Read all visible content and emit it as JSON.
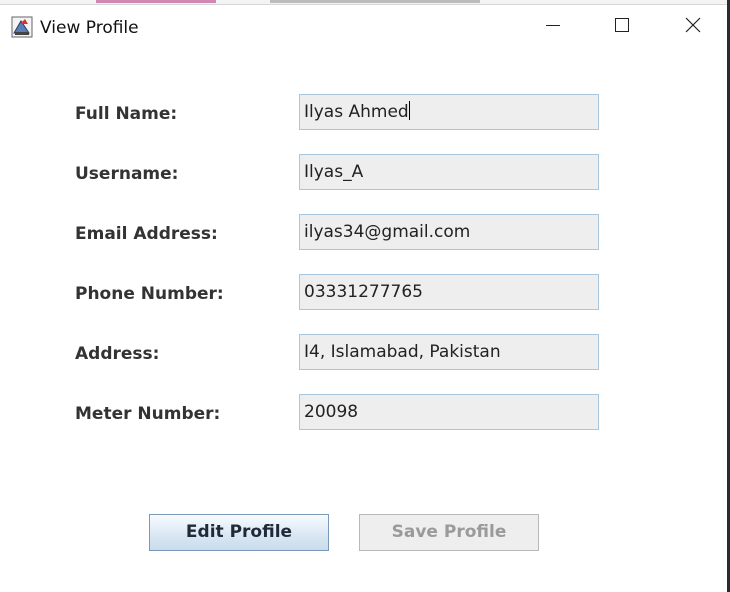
{
  "window": {
    "title": "View Profile",
    "icons": {
      "app": "app-logo-icon",
      "minimize": "minimize-icon",
      "maximize": "maximize-icon",
      "close": "close-icon"
    }
  },
  "form": {
    "fields": [
      {
        "label": "Full Name:",
        "value": "Ilyas Ahmed"
      },
      {
        "label": "Username:",
        "value": "Ilyas_A"
      },
      {
        "label": "Email Address:",
        "value": "ilyas34@gmail.com"
      },
      {
        "label": "Phone Number:",
        "value": "03331277765"
      },
      {
        "label": "Address:",
        "value": "I4, Islamabad, Pakistan"
      },
      {
        "label": "Meter Number:",
        "value": "20098"
      }
    ]
  },
  "buttons": {
    "edit_label": "Edit Profile",
    "save_label": "Save Profile"
  },
  "colors": {
    "field_bg": "#eeeeee",
    "field_border": "#a9c6dc",
    "label_text": "#333333",
    "disabled_text": "#9a9a9a"
  }
}
